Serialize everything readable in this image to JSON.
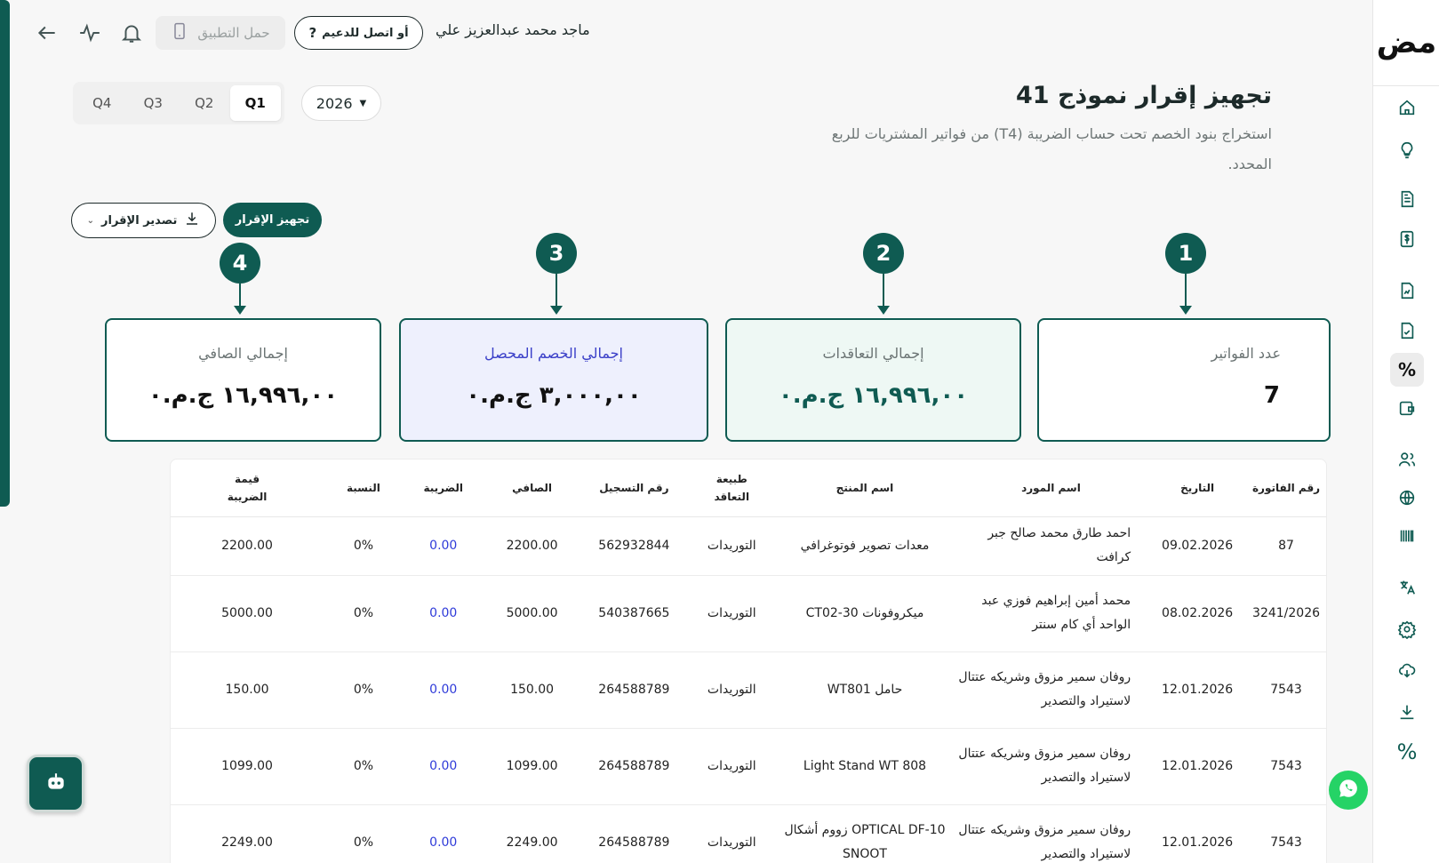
{
  "header": {
    "user_name": "ماجد محمد عبدالعزيز علي",
    "support_label": "أو اتصل للدعيم",
    "app_label": "حمل التطبيق"
  },
  "page": {
    "title": "تجهيز إقرار نموذج 41",
    "subtitle": "استخراج بنود الخصم تحت حساب الضريبة (T4) من فواتير المشتريات للربع المحدد."
  },
  "filters": {
    "quarters": [
      "Q1",
      "Q2",
      "Q3",
      "Q4"
    ],
    "active_quarter": "Q1",
    "year": "2026"
  },
  "actions": {
    "prepare_label": "تجهيز الإقرار",
    "export_label": "تصدير الإقرار"
  },
  "steps": [
    "1",
    "2",
    "3",
    "4"
  ],
  "cards": [
    {
      "label": "عدد الفواتير",
      "value": "7"
    },
    {
      "label": "إجمالي التعاقدات",
      "value": "١٦,٩٩٦,٠٠ ج.م.٠"
    },
    {
      "label": "إجمالي الخصم المحصل",
      "value": "٣,٠٠٠,٠٠ ج.م.٠"
    },
    {
      "label": "إجمالي الصافي",
      "value": "١٦,٩٩٦,٠٠ ج.م.٠"
    }
  ],
  "table": {
    "headers": [
      "رقم الفاتورة",
      "التاريخ",
      "اسم المورد",
      "اسم المنتج",
      "طبيعة التعاقد",
      "رقم التسجيل",
      "الصافي",
      "الضريبة",
      "النسبة",
      "قيمة الضريبة"
    ],
    "rows": [
      [
        "87",
        "09.02.2026",
        "احمد طارق محمد صالح جبر كرافت",
        "معدات تصوير فوتوغرافي",
        "التوريدات",
        "562932844",
        "2200.00",
        "0.00",
        "0%",
        "2200.00"
      ],
      [
        "3241/2026",
        "08.02.2026",
        "محمد أمين إبراهيم فوزي عبد الواحد أي كام سنتر",
        "ميكروفونات CT02-30",
        "التوريدات",
        "540387665",
        "5000.00",
        "0.00",
        "0%",
        "5000.00"
      ],
      [
        "7543",
        "12.01.2026",
        "روفان سمير مزوق وشريكه عتتال لاستيراد والتصدير",
        "حامل WT801",
        "التوريدات",
        "264588789",
        "150.00",
        "0.00",
        "0%",
        "150.00"
      ],
      [
        "7543",
        "12.01.2026",
        "روفان سمير مزوق وشريكه عتتال لاستيراد والتصدير",
        "Light Stand WT 808",
        "التوريدات",
        "264588789",
        "1099.00",
        "0.00",
        "0%",
        "1099.00"
      ],
      [
        "7543",
        "12.01.2026",
        "روفان سمير مزوق وشريكه عتتال لاستيراد والتصدير",
        "OPTICAL DF-10 زووم أشكال SNOOT",
        "التوريدات",
        "264588789",
        "2249.00",
        "0.00",
        "0%",
        "2249.00"
      ]
    ]
  },
  "sidebar": {
    "logo": "مض",
    "icons": [
      "home-icon",
      "lightbulb-icon",
      "document-icon",
      "dollar-icon",
      "invoice-icon",
      "file-icon",
      "percent-icon",
      "wallet-icon",
      "users-icon",
      "globe-icon",
      "barcode-icon",
      "translate-icon",
      "settings-icon",
      "cloud-icon",
      "download-icon",
      "percent-icon"
    ]
  }
}
